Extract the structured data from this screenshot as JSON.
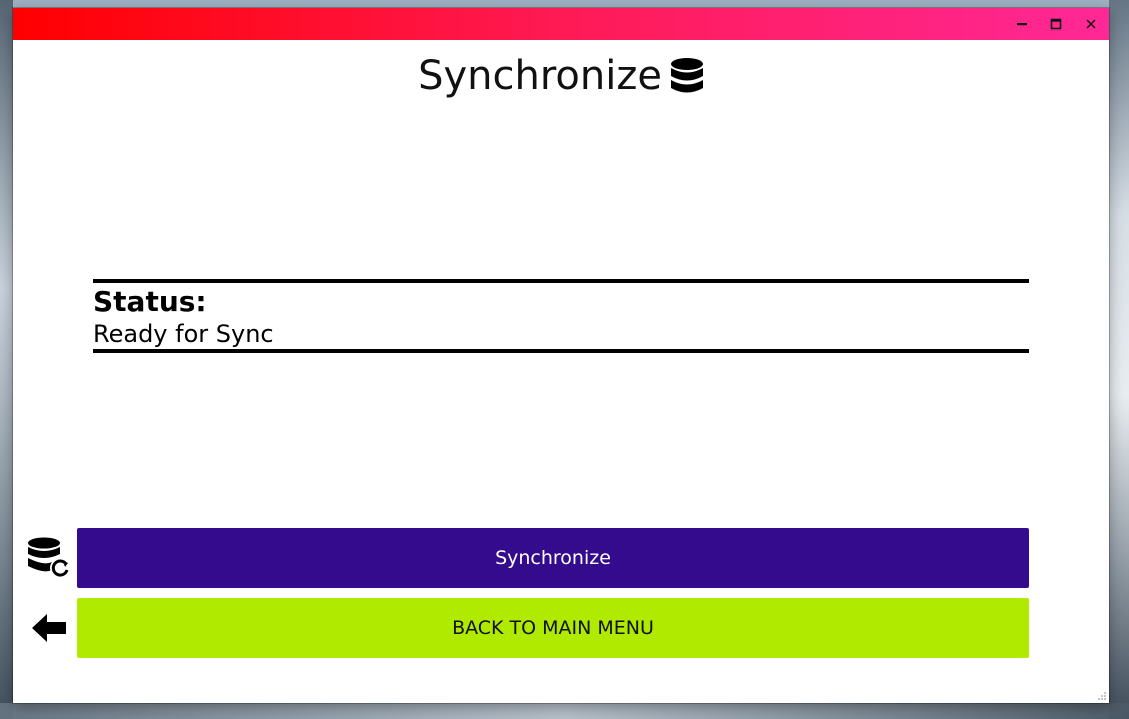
{
  "window": {
    "titlebar_gradient": [
      "#ff0000",
      "#ff2896"
    ],
    "controls": {
      "minimize_icon": "minimize-icon",
      "maximize_icon": "maximize-icon",
      "close_icon": "close-icon"
    }
  },
  "header": {
    "title": "Synchronize",
    "icon": "database-icon"
  },
  "status": {
    "label": "Status:",
    "value": "Ready for Sync"
  },
  "actions": {
    "synchronize": {
      "label": "Synchronize",
      "icon": "database-sync-icon",
      "color": "#330b8c"
    },
    "back": {
      "label": "BACK TO MAIN MENU",
      "icon": "arrow-left-icon",
      "color": "#afea00"
    }
  }
}
